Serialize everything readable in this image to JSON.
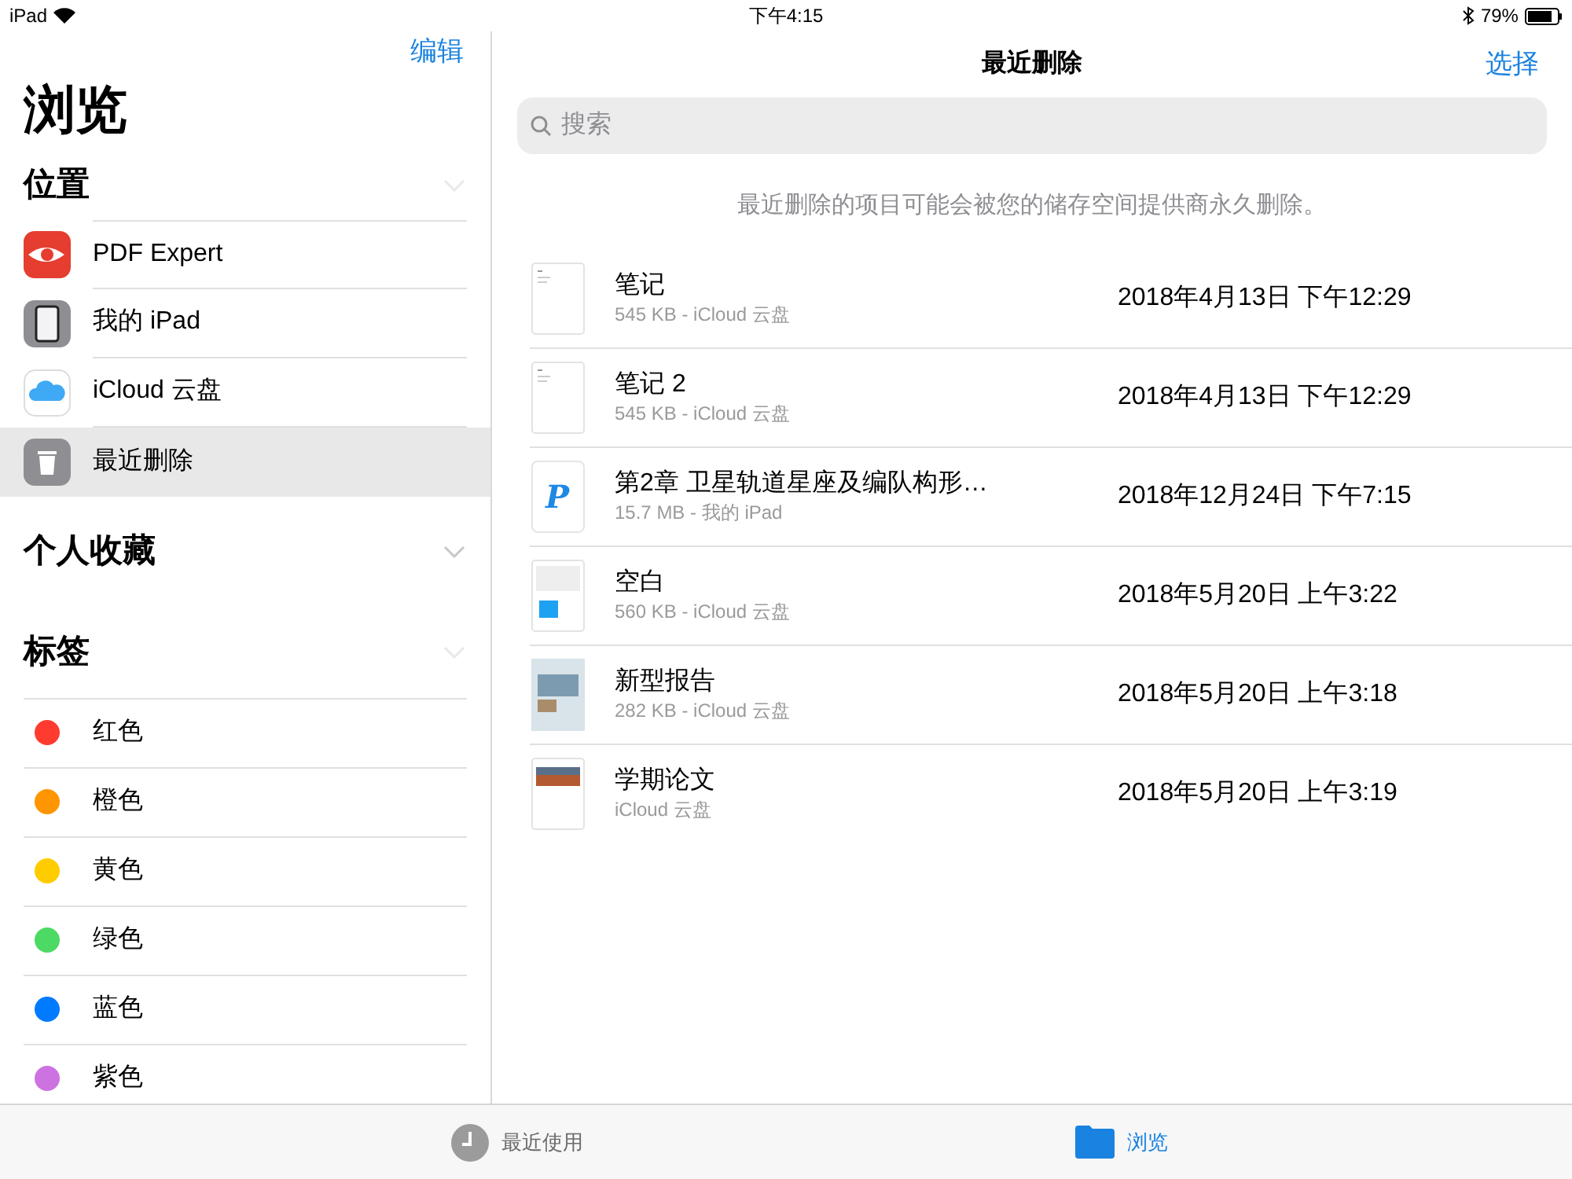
{
  "status_bar": {
    "device": "iPad",
    "time": "下午4:15",
    "battery": "79%"
  },
  "sidebar": {
    "edit": "编辑",
    "title": "浏览",
    "sections": [
      {
        "title": "位置",
        "expanded": true,
        "items": [
          {
            "label": "PDF Expert",
            "kind": "pdf-app",
            "selected": false
          },
          {
            "label": "我的 iPad",
            "kind": "ipad",
            "selected": false
          },
          {
            "label": "iCloud 云盘",
            "kind": "cloud",
            "selected": false
          },
          {
            "label": "最近删除",
            "kind": "trash",
            "selected": true
          }
        ]
      },
      {
        "title": "个人收藏",
        "expanded": false
      },
      {
        "title": "标签",
        "expanded": true,
        "tags": [
          {
            "label": "红色",
            "color": "#ff3b30"
          },
          {
            "label": "橙色",
            "color": "#ff9500"
          },
          {
            "label": "黄色",
            "color": "#ffcc00"
          },
          {
            "label": "绿色",
            "color": "#4cd964"
          },
          {
            "label": "蓝色",
            "color": "#007aff"
          },
          {
            "label": "紫色",
            "color": "#cc73e1"
          }
        ]
      }
    ]
  },
  "main": {
    "title": "最近删除",
    "select": "选择",
    "search": {
      "placeholder": "搜索"
    },
    "notice": "最近删除的项目可能会被您的储存空间提供商永久删除。",
    "files": [
      {
        "name": "笔记",
        "meta": "545 KB - iCloud 云盘",
        "date": "2018年4月13日 下午12:29",
        "kind": "note"
      },
      {
        "name": "笔记 2",
        "meta": "545 KB - iCloud 云盘",
        "date": "2018年4月13日 下午12:29",
        "kind": "note"
      },
      {
        "name": "第2章 卫星轨道星座及编队构形…",
        "meta": "15.7 MB - 我的 iPad",
        "date": "2018年12月24日 下午7:15",
        "kind": "pdf",
        "glyph": "P"
      },
      {
        "name": "空白",
        "meta": "560 KB - iCloud 云盘",
        "date": "2018年5月20日 上午3:22",
        "kind": "sheet"
      },
      {
        "name": "新型报告",
        "meta": "282 KB - iCloud 云盘",
        "date": "2018年5月20日 上午3:18",
        "kind": "report"
      },
      {
        "name": "学期论文",
        "meta": "iCloud 云盘",
        "date": "2018年5月20日 上午3:19",
        "kind": "paper"
      }
    ]
  },
  "tab_bar": [
    {
      "label": "最近使用",
      "kind": "clock",
      "selected": false
    },
    {
      "label": "浏览",
      "kind": "folder",
      "selected": true
    }
  ]
}
